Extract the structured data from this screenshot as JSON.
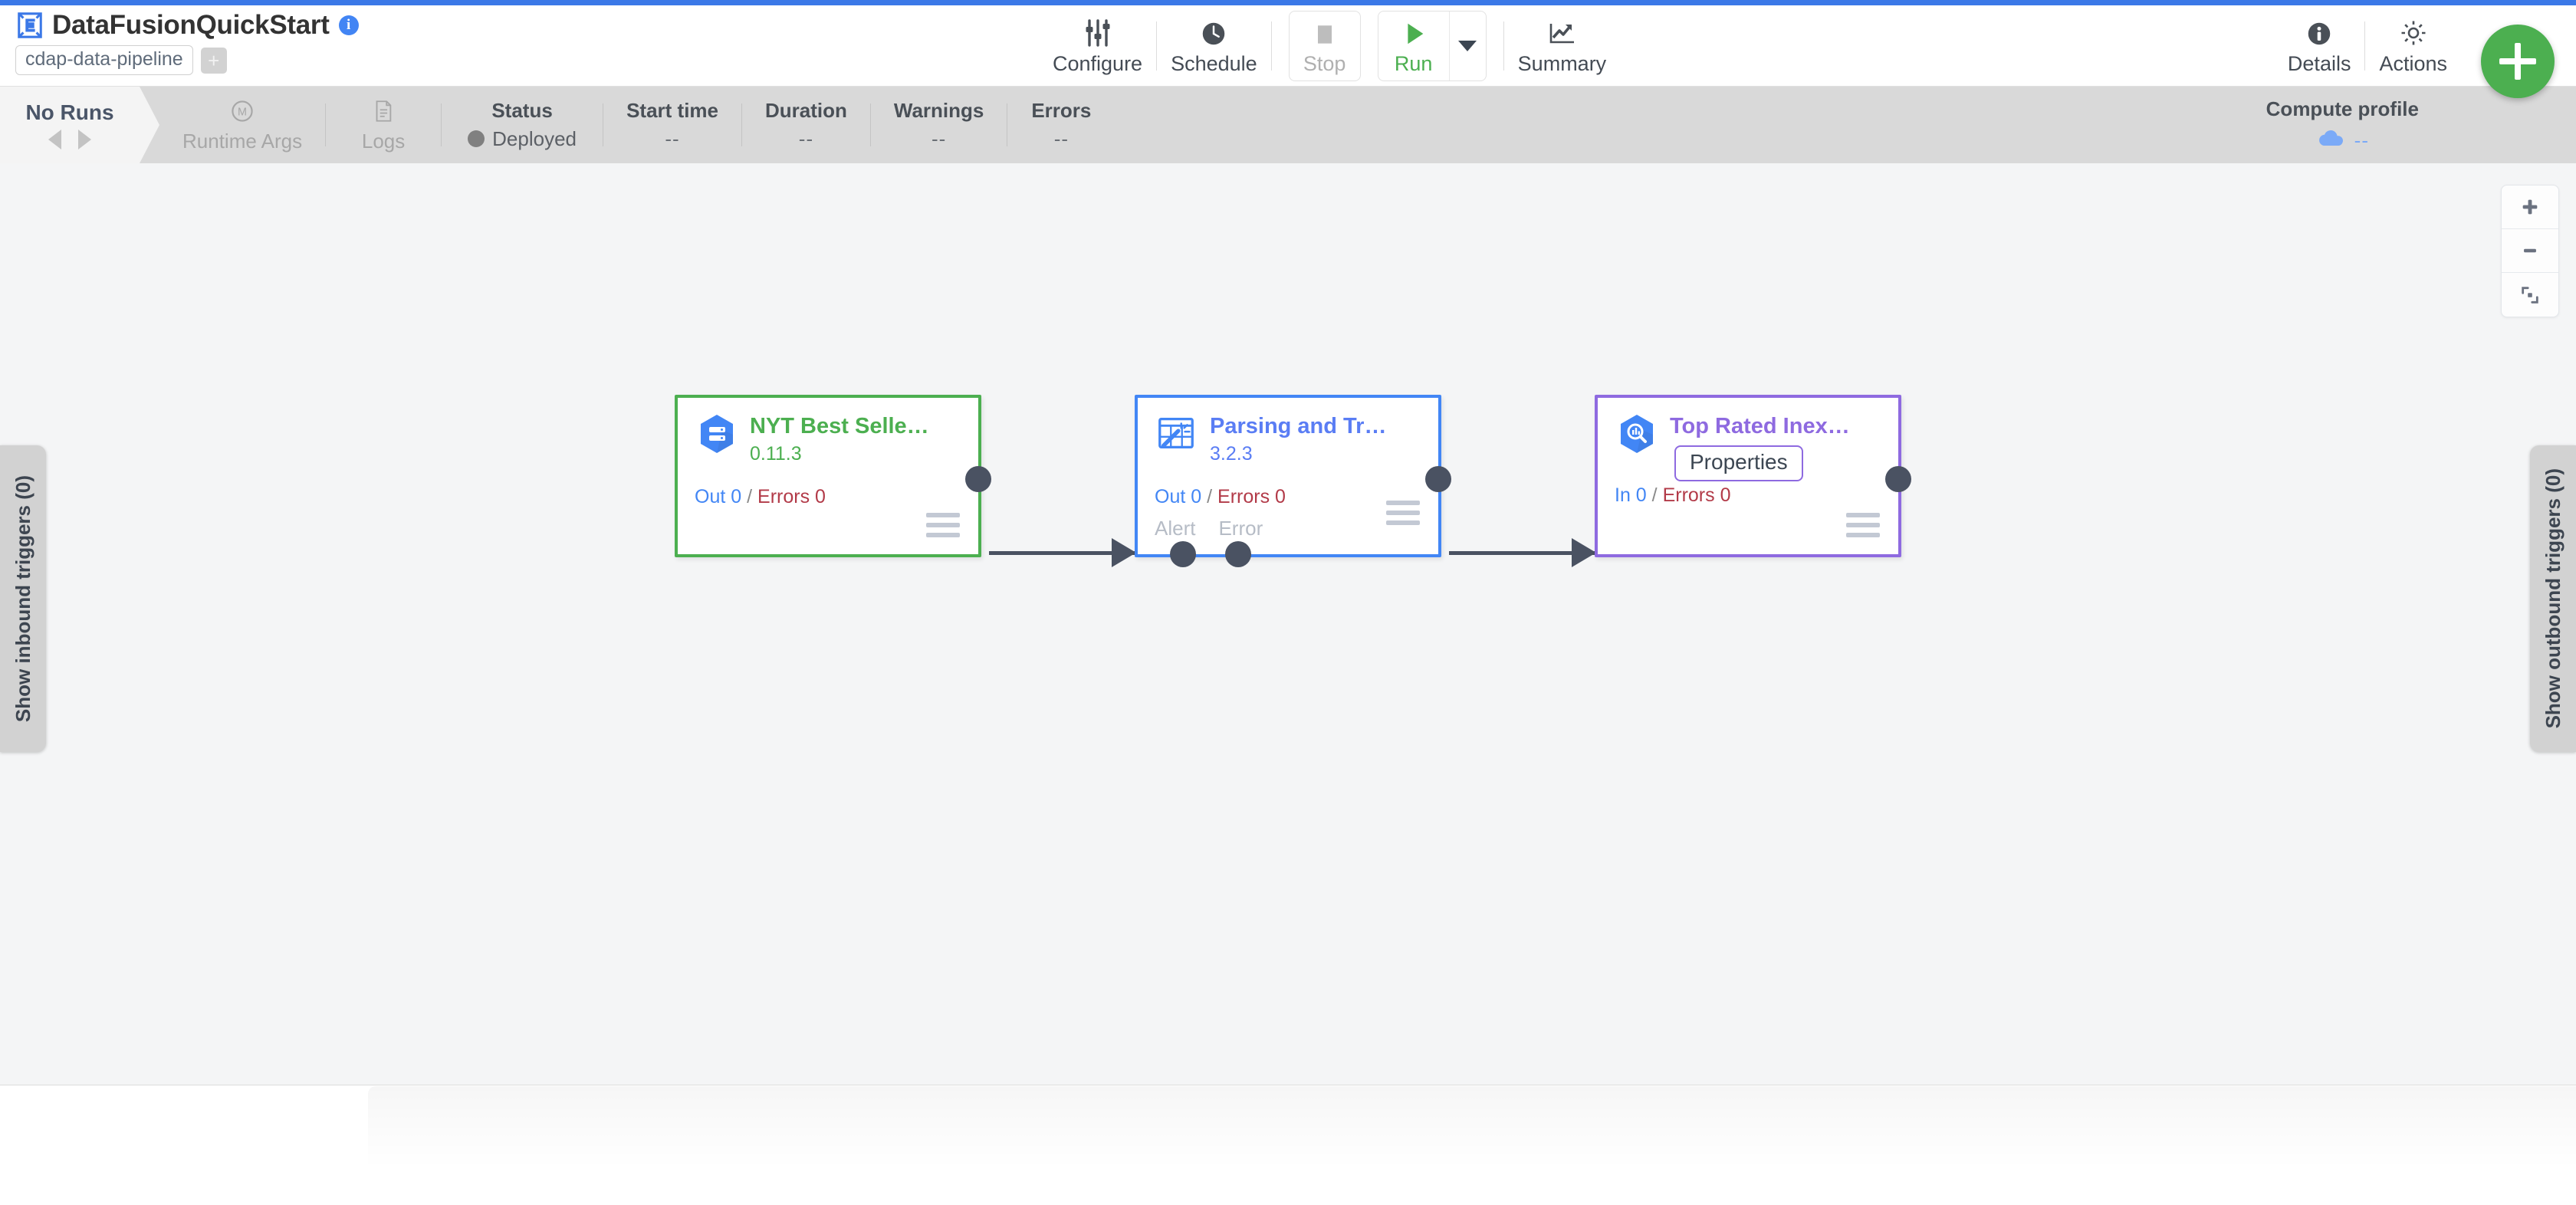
{
  "accent_color": "#3b78e7",
  "header": {
    "logo_icon": "cdap-logo-icon",
    "pipeline_name": "DataFusionQuickStart",
    "info_icon": "info-icon",
    "info_glyph": "i",
    "artifact_type": "cdap-data-pipeline",
    "add_tag_label": "+"
  },
  "toolbar": {
    "configure": {
      "label": "Configure",
      "icon": "sliders-icon"
    },
    "schedule": {
      "label": "Schedule",
      "icon": "clock-icon"
    },
    "stop": {
      "label": "Stop",
      "icon": "stop-square-icon"
    },
    "run": {
      "label": "Run",
      "icon": "play-triangle-icon"
    },
    "run_caret_icon": "chevron-down-icon",
    "summary": {
      "label": "Summary",
      "icon": "trending-up-icon"
    },
    "details": {
      "label": "Details",
      "icon": "info-circle-icon"
    },
    "actions": {
      "label": "Actions",
      "icon": "gear-icon"
    },
    "fab_label": "+"
  },
  "runbar": {
    "no_runs_label": "No Runs",
    "prev_icon": "triangle-left-icon",
    "next_icon": "triangle-right-icon",
    "runtime_args": {
      "label": "Runtime Args",
      "icon": "macro-m-icon"
    },
    "logs": {
      "label": "Logs",
      "icon": "document-icon"
    },
    "status": {
      "title": "Status",
      "value": "Deployed",
      "dot_color": "#808080"
    },
    "start_time": {
      "title": "Start time",
      "value": "--"
    },
    "duration": {
      "title": "Duration",
      "value": "--"
    },
    "warnings": {
      "title": "Warnings",
      "value": "--"
    },
    "errors": {
      "title": "Errors",
      "value": "--"
    },
    "compute_profile": {
      "title": "Compute profile",
      "value": "--",
      "icon": "cloud-icon"
    }
  },
  "canvas": {
    "inbound_triggers_tab": "Show inbound triggers (0)",
    "outbound_triggers_tab": "Show outbound triggers (0)",
    "zoom_in_icon": "plus-icon",
    "zoom_out_icon": "minus-icon",
    "fit_icon": "fit-to-screen-icon"
  },
  "nodes": [
    {
      "id": "nyt-best-sellers",
      "name": "NYT Best Selle…",
      "version": "0.11.3",
      "icon": "bigquery-table-icon",
      "metrics": {
        "in_label": "Out 0",
        "sep": "/",
        "errors_label": "Errors 0"
      },
      "ports": [],
      "menu_icon": "hamburger-menu-icon",
      "border_color": "#4caf50",
      "tooltip": null
    },
    {
      "id": "parsing-and-transform",
      "name": "Parsing and Tr…",
      "version": "3.2.3",
      "icon": "wrangler-magic-icon",
      "metrics": {
        "in_label": "Out 0",
        "sep": "/",
        "errors_label": "Errors 0"
      },
      "ports": [
        "Alert",
        "Error"
      ],
      "menu_icon": "hamburger-menu-icon",
      "border_color": "#4286f5",
      "tooltip": null
    },
    {
      "id": "top-rated-inexpensive",
      "name": "Top Rated Inex…",
      "version": "",
      "icon": "bigquery-search-icon",
      "metrics": {
        "in_label": "In 0",
        "sep": "/",
        "errors_label": "Errors 0"
      },
      "ports": [],
      "menu_icon": "hamburger-menu-icon",
      "border_color": "#8e6ae0",
      "tooltip": "Properties"
    }
  ]
}
